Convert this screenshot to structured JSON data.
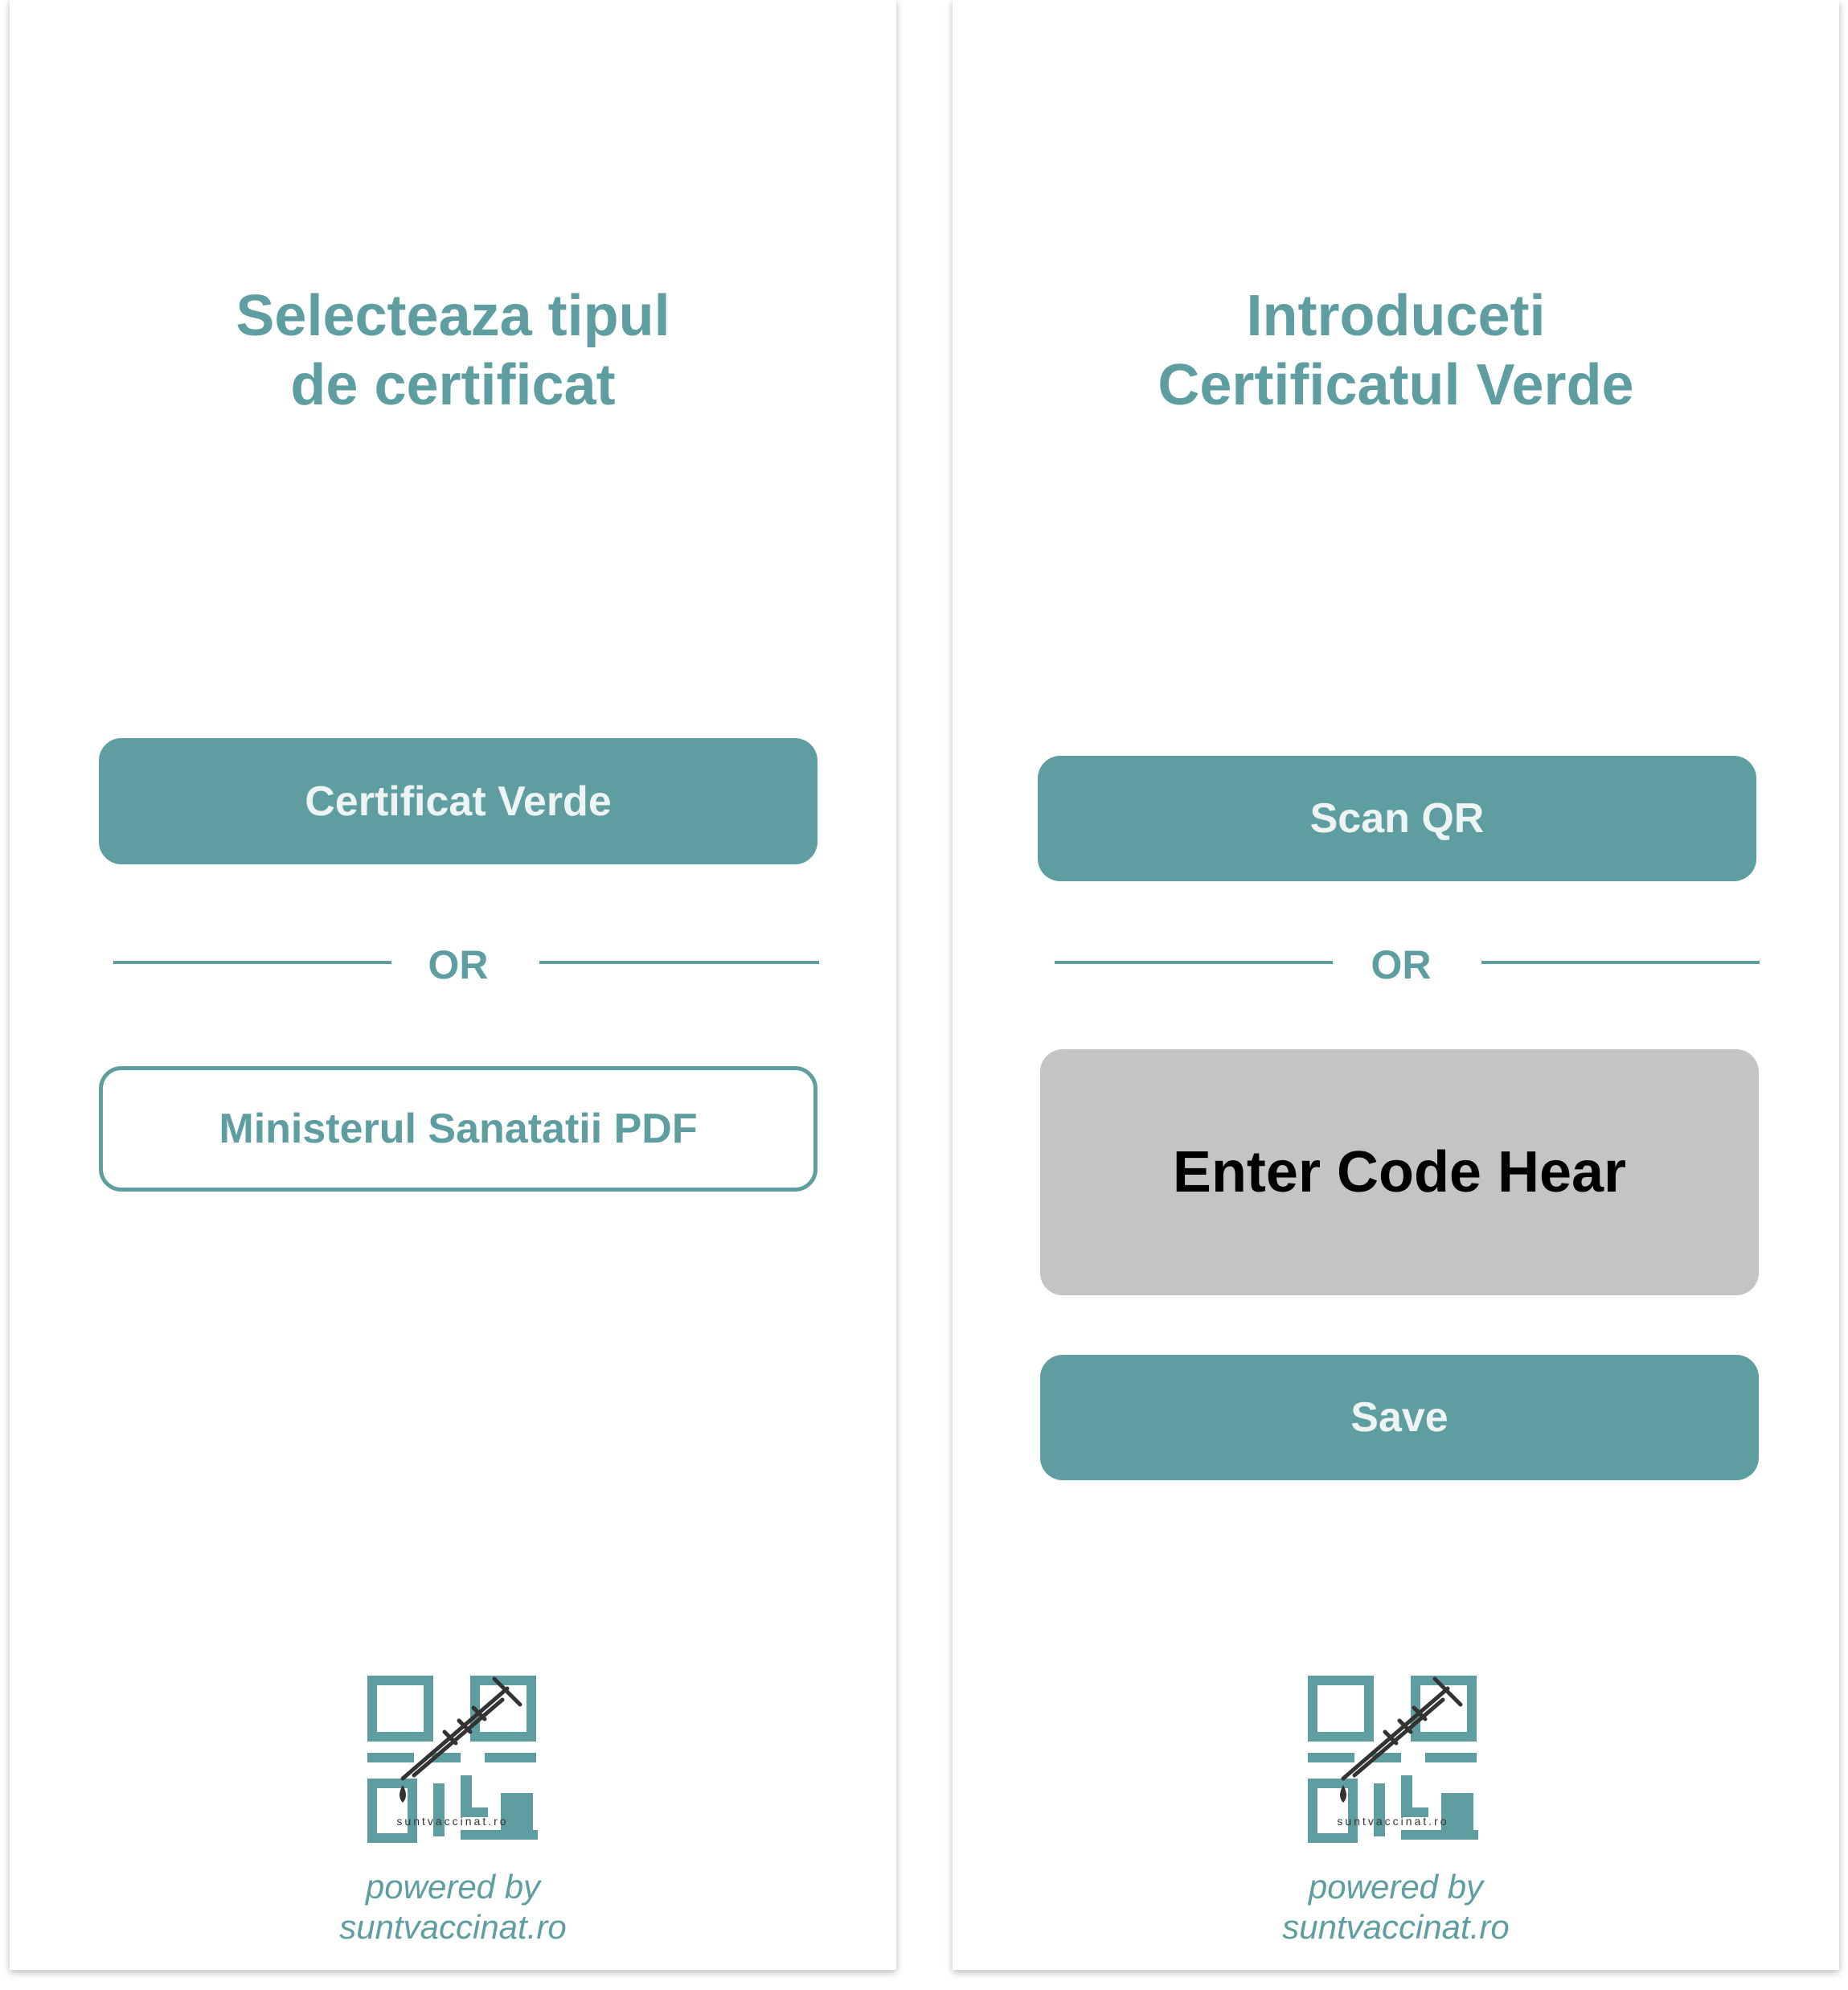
{
  "colors": {
    "accent": "#5f9ea0",
    "button_text": "#eef4f4",
    "input_bg": "#c4c4c4",
    "input_text": "#000000"
  },
  "left_screen": {
    "title_line1": "Selecteaza tipul",
    "title_line2": "de certificat",
    "primary_button": "Certificat Verde",
    "divider_text": "OR",
    "secondary_button": "Ministerul Sanatatii PDF",
    "logo_icon": "qr-syringe-logo-icon",
    "logo_text": "suntvaccinat.ro",
    "footer_line1": "powered by",
    "footer_line2": "suntvaccinat.ro"
  },
  "right_screen": {
    "title_line1": "Introduceti",
    "title_line2": "Certificatul Verde",
    "scan_button": "Scan QR",
    "divider_text": "OR",
    "code_placeholder": "Enter Code Hear",
    "save_button": "Save",
    "logo_icon": "qr-syringe-logo-icon",
    "logo_text": "suntvaccinat.ro",
    "footer_line1": "powered by",
    "footer_line2": "suntvaccinat.ro"
  }
}
